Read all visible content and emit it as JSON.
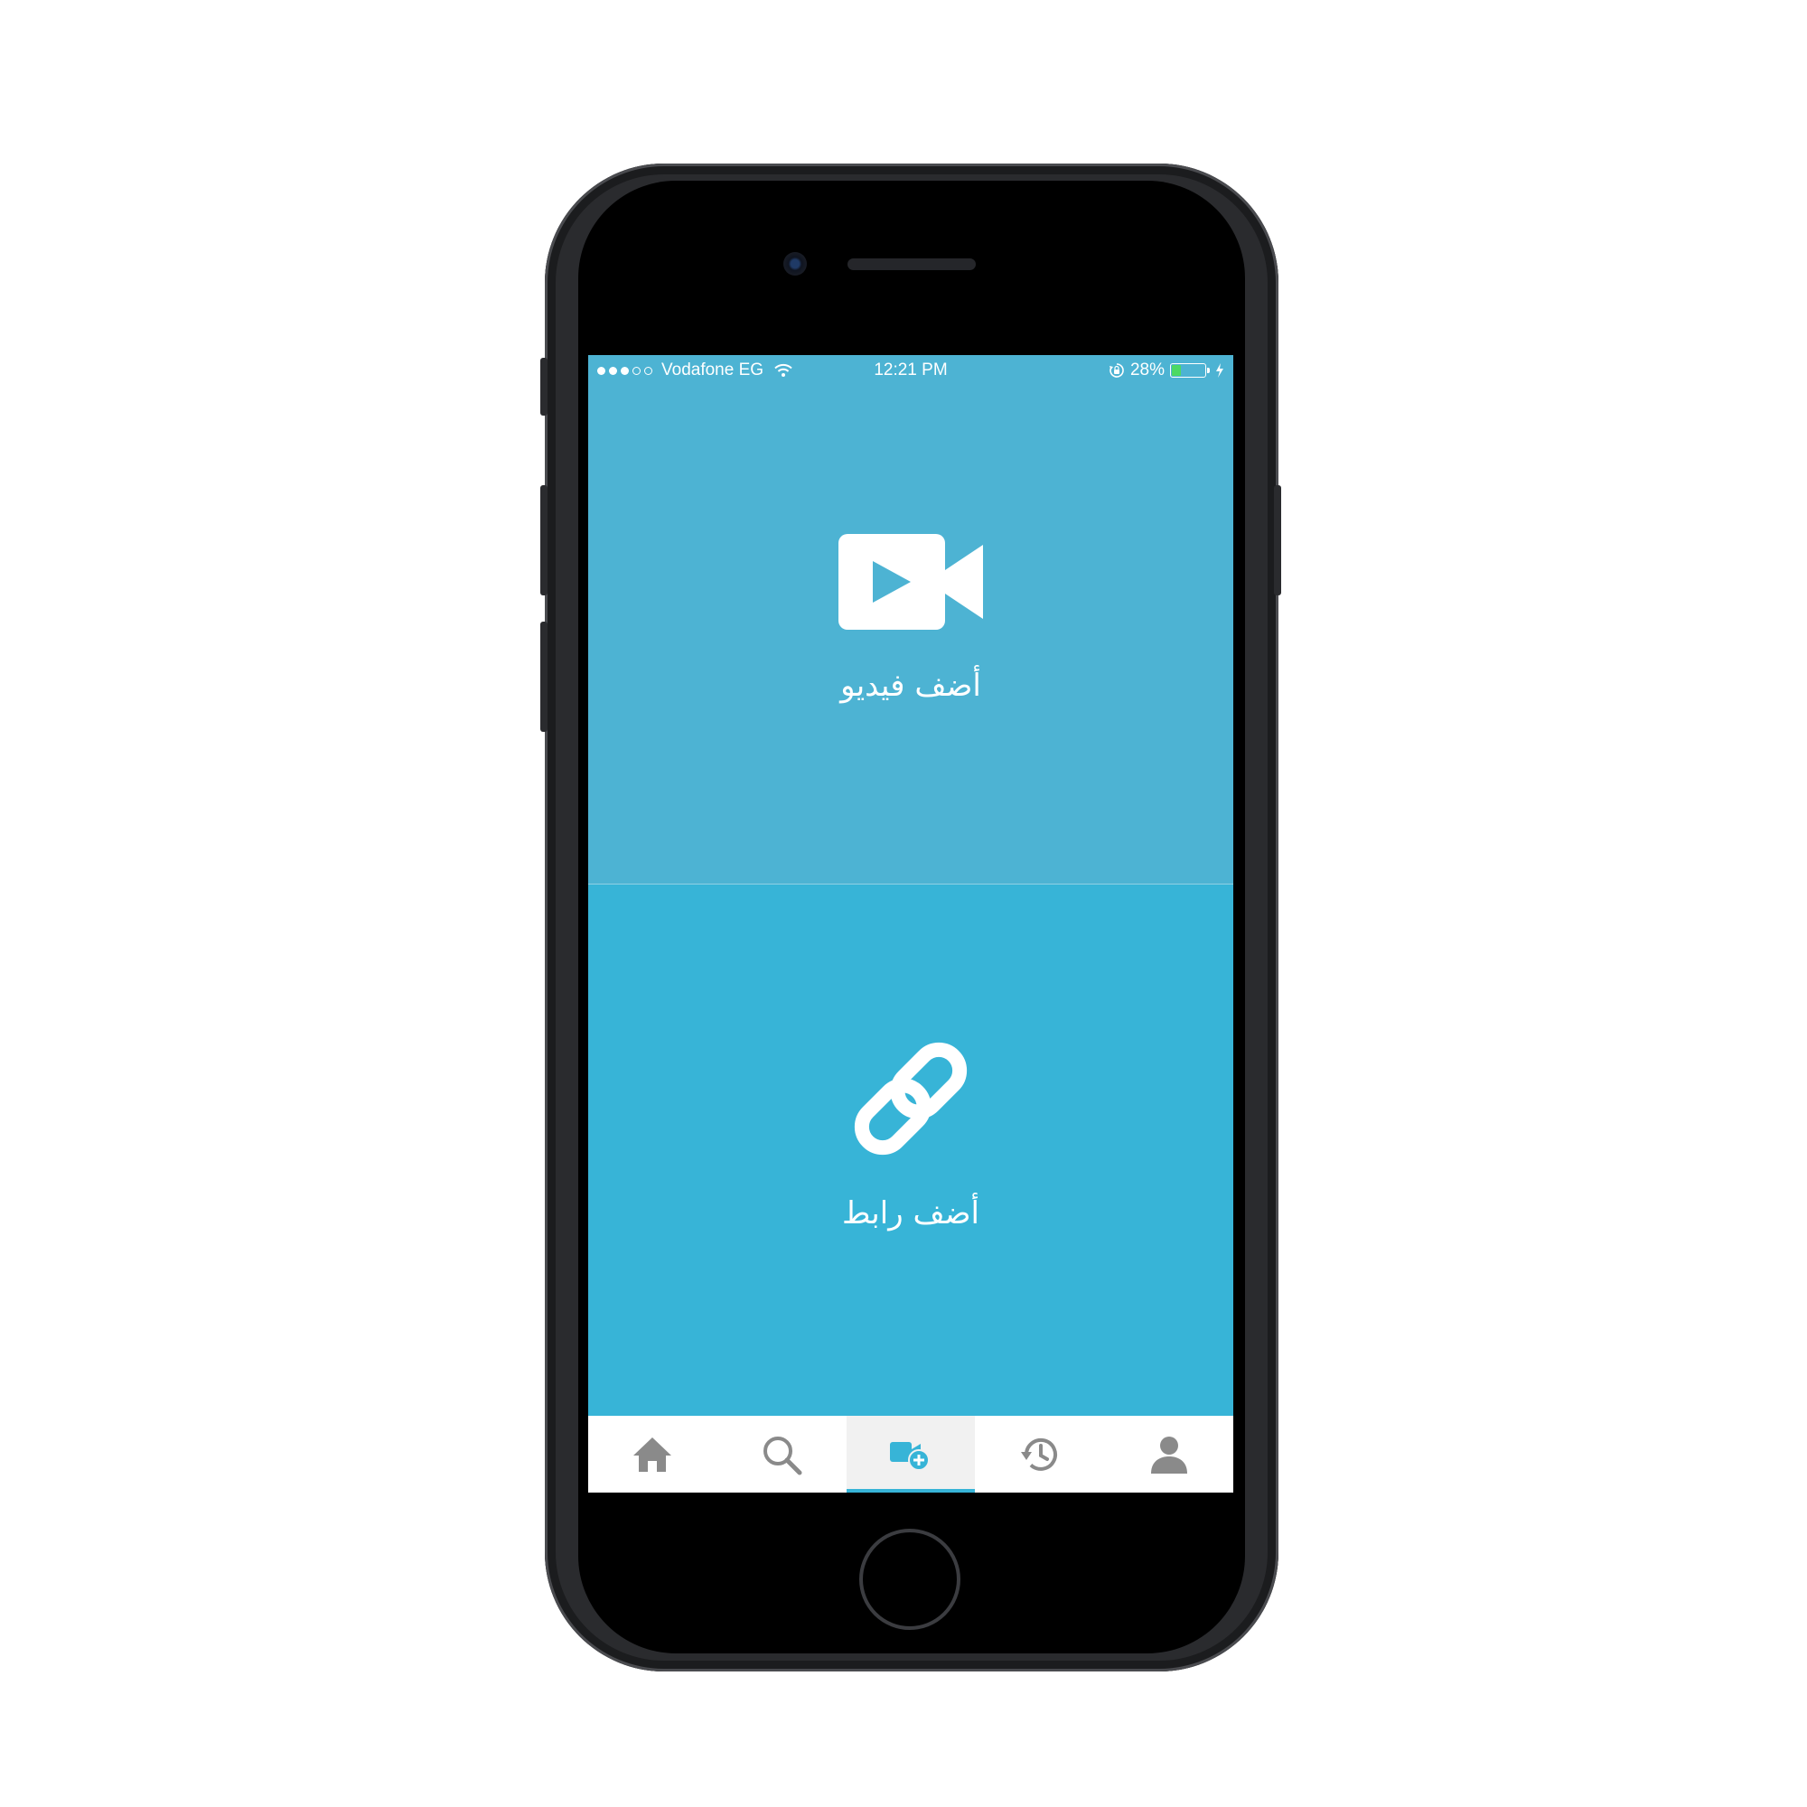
{
  "status_bar": {
    "signal_filled": 3,
    "signal_total": 5,
    "carrier": "Vodafone EG",
    "time": "12:21 PM",
    "battery_percent": "28%",
    "battery_level": 0.28
  },
  "actions": {
    "add_video_label": "أضف فيديو",
    "add_link_label": "أضف رابط"
  },
  "tab_bar": {
    "tabs": [
      {
        "icon": "home-icon",
        "active": false
      },
      {
        "icon": "search-icon",
        "active": false
      },
      {
        "icon": "add-video-icon",
        "active": true
      },
      {
        "icon": "history-icon",
        "active": false
      },
      {
        "icon": "profile-icon",
        "active": false
      }
    ]
  },
  "colors": {
    "video_panel": "#4db3d3",
    "link_panel": "#37b4d7",
    "tab_icon": "#8a8a8a",
    "tab_active_icon": "#37b4d7",
    "battery": "#4cd964"
  }
}
